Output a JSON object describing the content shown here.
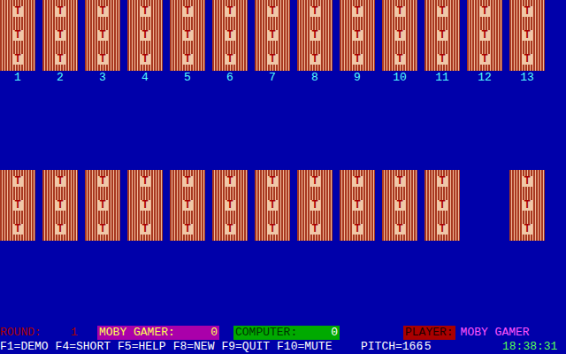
{
  "card_back_glyph": "T",
  "top_row": [
    {
      "label": "1",
      "face_down": true
    },
    {
      "label": "2",
      "face_down": true
    },
    {
      "label": "3",
      "face_down": true
    },
    {
      "label": "4",
      "face_down": true
    },
    {
      "label": "5",
      "face_down": true
    },
    {
      "label": "6",
      "face_down": true
    },
    {
      "label": "7",
      "face_down": true
    },
    {
      "label": "8",
      "face_down": true
    },
    {
      "label": "9",
      "face_down": true
    },
    {
      "label": "10",
      "face_down": true
    },
    {
      "label": "11",
      "face_down": true
    },
    {
      "label": "12",
      "face_down": true
    },
    {
      "label": "13",
      "face_down": true
    }
  ],
  "bottom_row": [
    {
      "present": true
    },
    {
      "present": true
    },
    {
      "present": true
    },
    {
      "present": true
    },
    {
      "present": true
    },
    {
      "present": true
    },
    {
      "present": true
    },
    {
      "present": true
    },
    {
      "present": true
    },
    {
      "present": true
    },
    {
      "present": true
    },
    {
      "present": false
    },
    {
      "present": true
    }
  ],
  "status": {
    "round_label": "ROUND:",
    "round": "1",
    "player1_label": "MOBY GAMER:",
    "player1_score": "0",
    "computer_label": "COMPUTER:",
    "computer_score": "0",
    "player_label": "PLAYER:",
    "player_name": "MOBY GAMER"
  },
  "keys": [
    "F1=DEMO",
    "F4=SHORT",
    "F5=HELP",
    "F8=NEW",
    "F9=QUIT",
    "F10=MUTE"
  ],
  "pitch": "PITCH=166",
  "speed": ".5",
  "clock": "18:38:31"
}
